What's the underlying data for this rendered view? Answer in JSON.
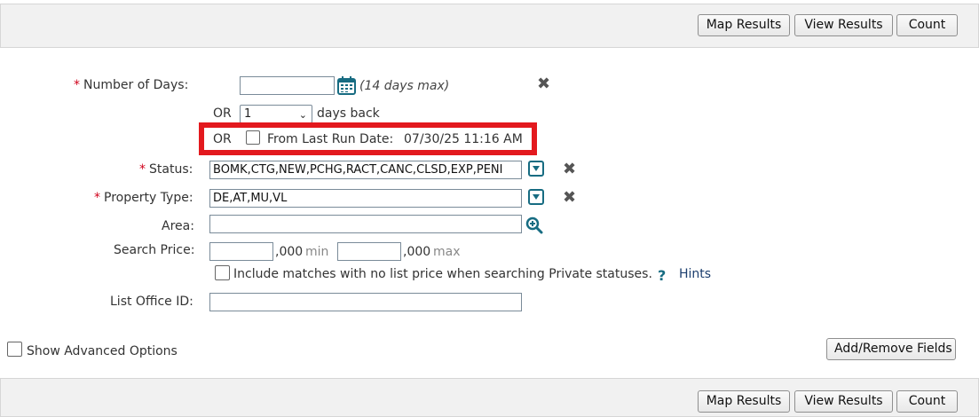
{
  "toolbar": {
    "map_results": "Map Results",
    "view_results": "View Results",
    "count": "Count"
  },
  "form": {
    "number_of_days": {
      "required": "*",
      "label": "Number of Days:",
      "value": "",
      "hint": "(14 days max)"
    },
    "days_back": {
      "or": "OR",
      "selected": "1",
      "suffix": "days back"
    },
    "last_run": {
      "or": "OR",
      "label": "From Last Run Date:",
      "value": "07/30/25 11:16 AM",
      "checked": false
    },
    "status": {
      "required": "*",
      "label": "Status:",
      "value": "BOMK,CTG,NEW,PCHG,RACT,CANC,CLSD,EXP,PENI"
    },
    "property_type": {
      "required": "*",
      "label": "Property Type:",
      "value": "DE,AT,MU,VL"
    },
    "area": {
      "label": "Area:",
      "value": ""
    },
    "search_price": {
      "label": "Search Price:",
      "min_value": "",
      "min_suffix": ",000",
      "min_label": "min",
      "max_value": "",
      "max_suffix": ",000",
      "max_label": "max"
    },
    "include_no_price": {
      "label": "Include matches with no list price when searching Private statuses.",
      "checked": false
    },
    "hints": {
      "icon": "?",
      "label": "Hints"
    },
    "list_office": {
      "label": "List Office ID:",
      "value": ""
    }
  },
  "advanced": {
    "label": "Show Advanced Options",
    "checked": false
  },
  "add_remove": "Add/Remove Fields",
  "icons": {
    "calendar": "calendar-icon",
    "close": "close-icon",
    "dropdown": "dropdown-icon",
    "search": "zoom-icon"
  },
  "colors": {
    "accent": "#176c82",
    "required": "#d0021b",
    "highlight": "#e3191e"
  }
}
